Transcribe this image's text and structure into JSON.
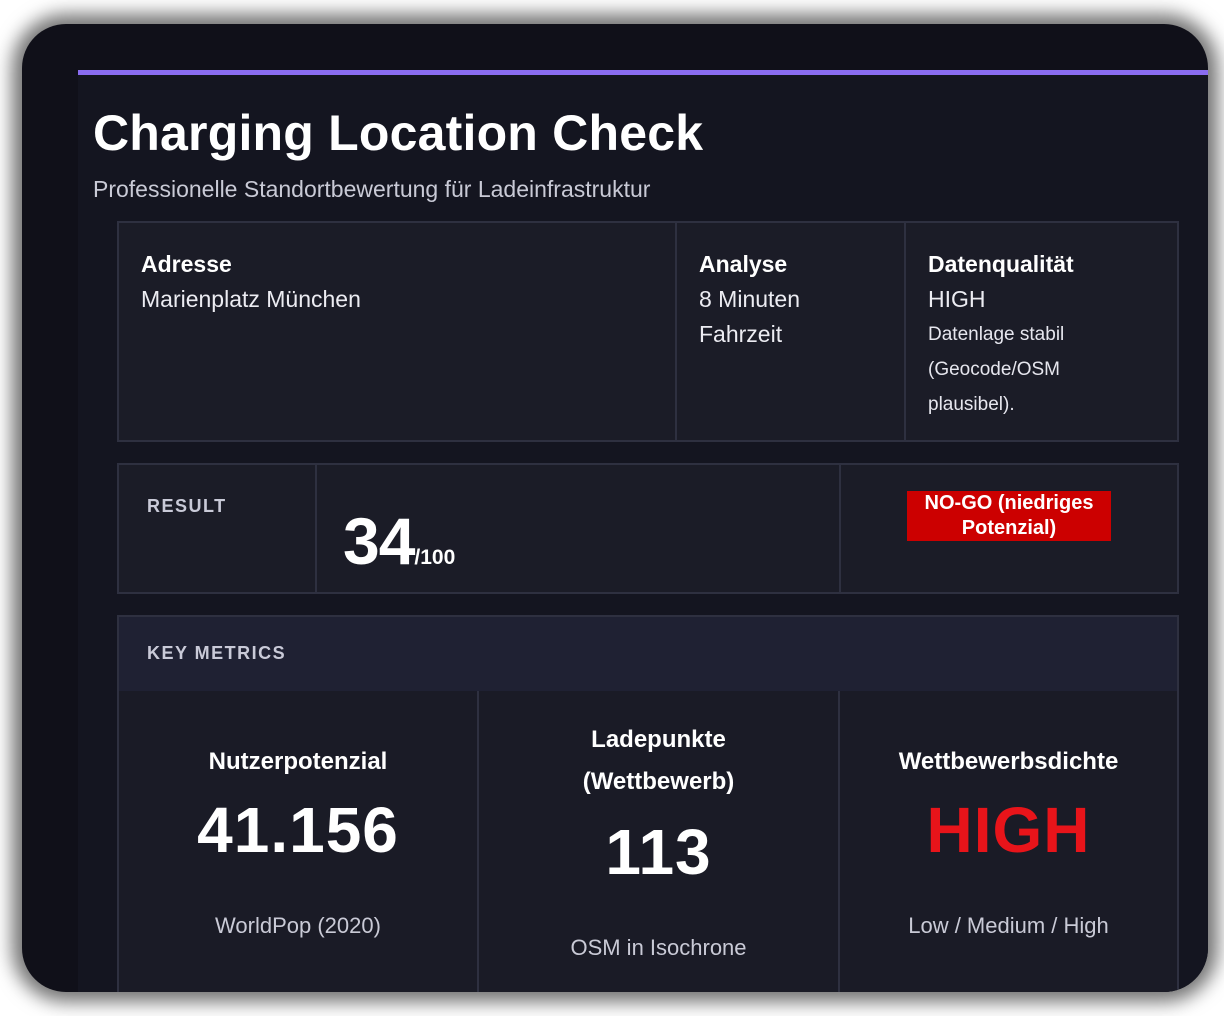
{
  "app": {
    "title": "Charging Location Check",
    "subtitle": "Professionelle Standortbewertung für Ladeinfrastruktur"
  },
  "info": {
    "address_label": "Adresse",
    "address_value": "Marienplatz München",
    "analysis_label": "Analyse",
    "analysis_value_line1": "8 Minuten",
    "analysis_value_line2": "Fahrzeit",
    "quality_label": "Datenqualität",
    "quality_value": "HIGH",
    "quality_note_line1": "Datenlage stabil",
    "quality_note_line2": "(Geocode/OSM",
    "quality_note_line3": "plausibel)."
  },
  "result": {
    "label": "RESULT",
    "score": "34",
    "score_max": "/100",
    "verdict": "NO-GO (niedriges Potenzial)",
    "verdict_color": "#cc0000"
  },
  "metrics": {
    "header": "KEY METRICS",
    "items": [
      {
        "label": "Nutzerpotenzial",
        "value": "41.156",
        "sub": "WorldPop (2020)"
      },
      {
        "label_line1": "Ladepunkte",
        "label_line2": "(Wettbewerb)",
        "value": "113",
        "sub": "OSM in Isochrone"
      },
      {
        "label": "Wettbewerbsdichte",
        "value": "HIGH",
        "sub": "Low / Medium / High",
        "value_color": "#e8141a"
      }
    ]
  },
  "colors": {
    "accent": "#8a6cf0",
    "background": "#141520",
    "panel": "#1b1c27",
    "border": "#2e3040"
  }
}
